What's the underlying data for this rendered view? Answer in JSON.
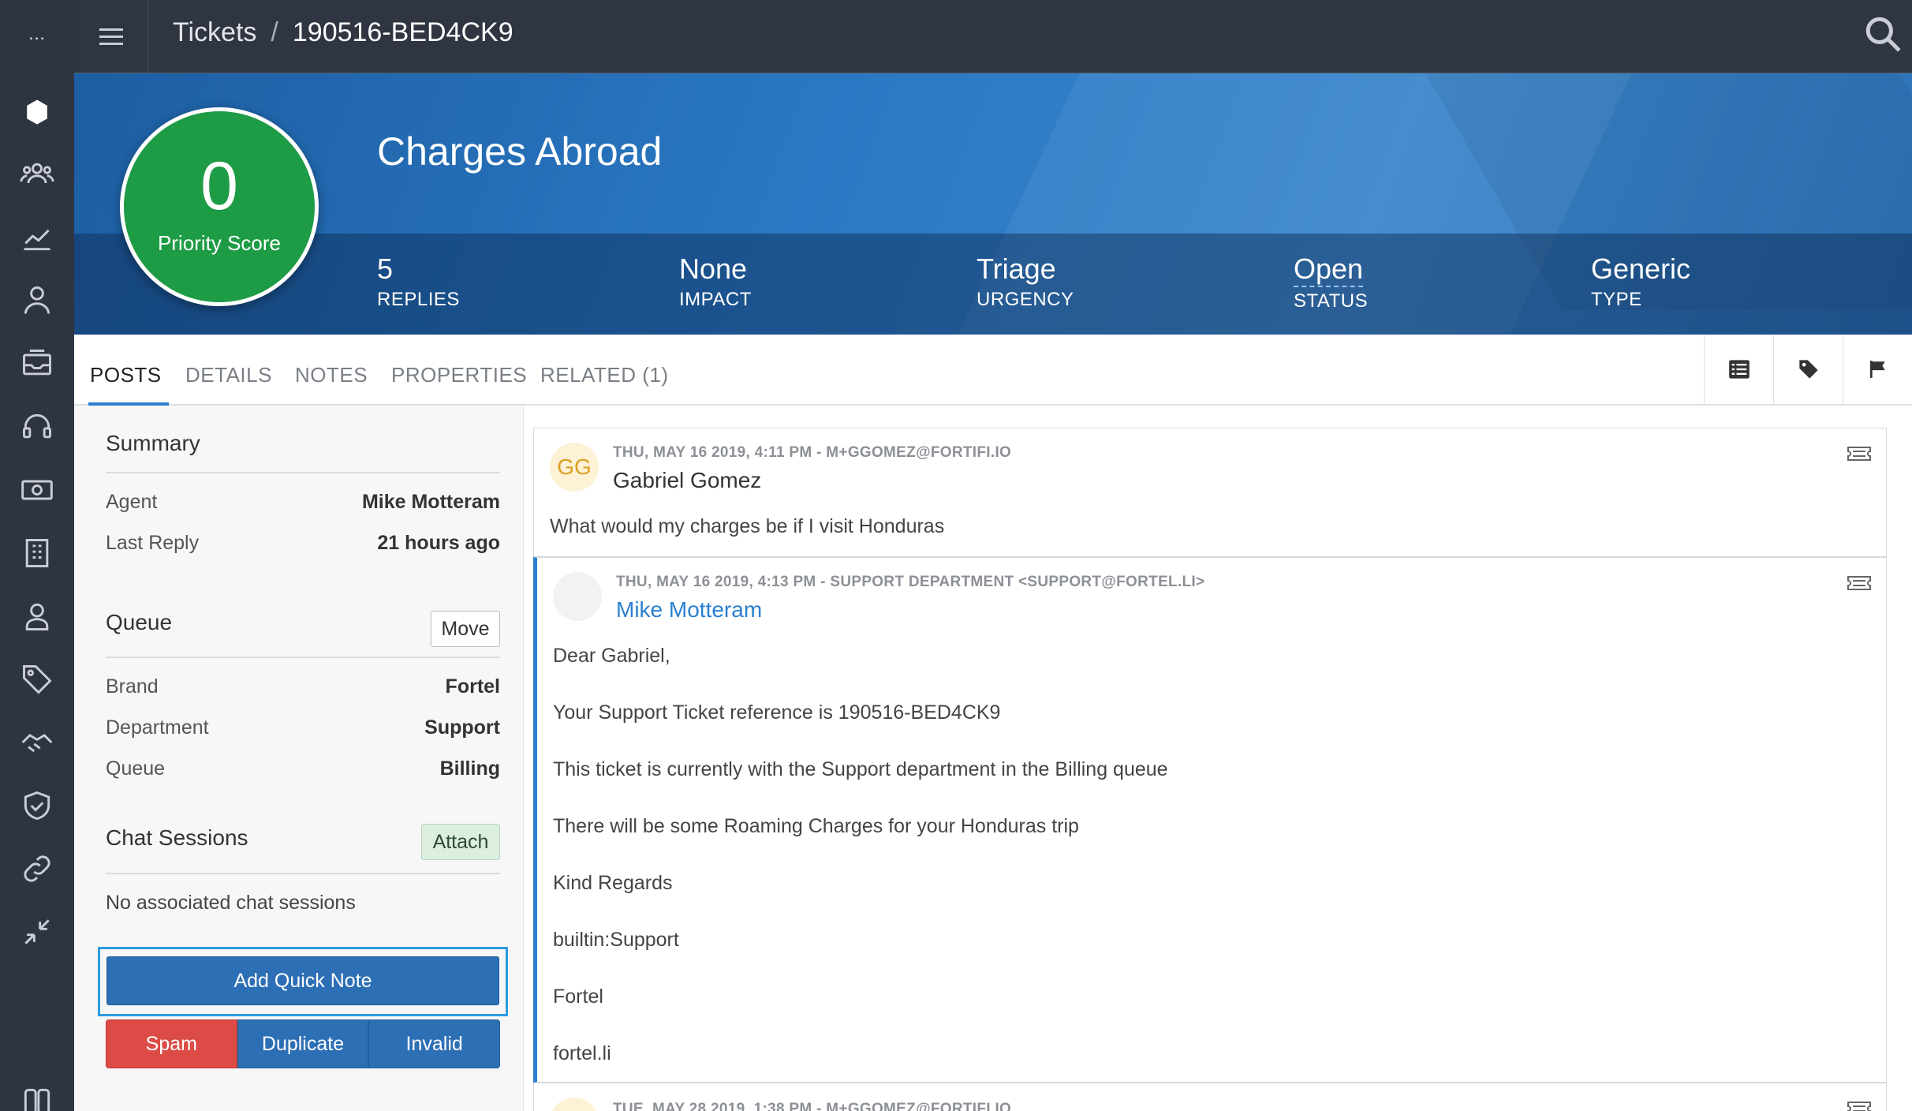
{
  "rail": {
    "dots": "..."
  },
  "topbar": {
    "breadcrumb_root": "Tickets",
    "breadcrumb_sep": "/",
    "breadcrumb_current": "190516-BED4CK9"
  },
  "hero": {
    "title": "Charges Abroad",
    "score_value": "0",
    "score_label": "Priority Score",
    "stats": [
      {
        "value": "5",
        "label": "REPLIES"
      },
      {
        "value": "None",
        "label": "IMPACT"
      },
      {
        "value": "Triage",
        "label": "URGENCY"
      },
      {
        "value": "Open",
        "label": "STATUS"
      },
      {
        "value": "Generic",
        "label": "TYPE"
      }
    ]
  },
  "tabs": [
    "POSTS",
    "DETAILS",
    "NOTES",
    "PROPERTIES",
    "RELATED (1)"
  ],
  "summary": {
    "heading": "Summary",
    "agent_label": "Agent",
    "agent_value": "Mike Motteram",
    "last_reply_label": "Last Reply",
    "last_reply_value": "21 hours ago"
  },
  "queue": {
    "heading": "Queue",
    "move_label": "Move",
    "brand_label": "Brand",
    "brand_value": "Fortel",
    "department_label": "Department",
    "department_value": "Support",
    "queue_label": "Queue",
    "queue_value": "Billing"
  },
  "chat": {
    "heading": "Chat Sessions",
    "attach_label": "Attach",
    "empty_text": "No associated chat sessions"
  },
  "actions": {
    "quick_note": "Add Quick Note",
    "spam": "Spam",
    "duplicate": "Duplicate",
    "invalid": "Invalid"
  },
  "posts": [
    {
      "initials": "GG",
      "meta": "THU, MAY 16 2019, 4:11 PM - M+GGOMEZ@FORTIFI.IO",
      "author": "Gabriel Gomez",
      "lines": [
        "What would my charges be if I visit Honduras"
      ]
    },
    {
      "initials": "",
      "meta": "THU, MAY 16 2019, 4:13 PM - SUPPORT DEPARTMENT <SUPPORT@FORTEL.LI>",
      "author": "Mike Motteram",
      "lines": [
        "Dear Gabriel,",
        "Your Support Ticket reference is 190516-BED4CK9",
        "This ticket is currently with the Support department in the Billing queue",
        "There will be some Roaming Charges for your Honduras trip",
        "Kind Regards",
        "builtin:Support",
        "Fortel",
        "fortel.li"
      ]
    },
    {
      "initials": "",
      "meta": "TUE, MAY 28 2019, 1:38 PM - M+GGOMEZ@FORTIFI.IO",
      "author": "",
      "lines": []
    }
  ],
  "colors": {
    "rail": "#2e3440",
    "hero_blue": "#2a78c3",
    "score_green": "#1e9b45",
    "accent": "#2b7fd0",
    "spam_red": "#dc4b46"
  }
}
